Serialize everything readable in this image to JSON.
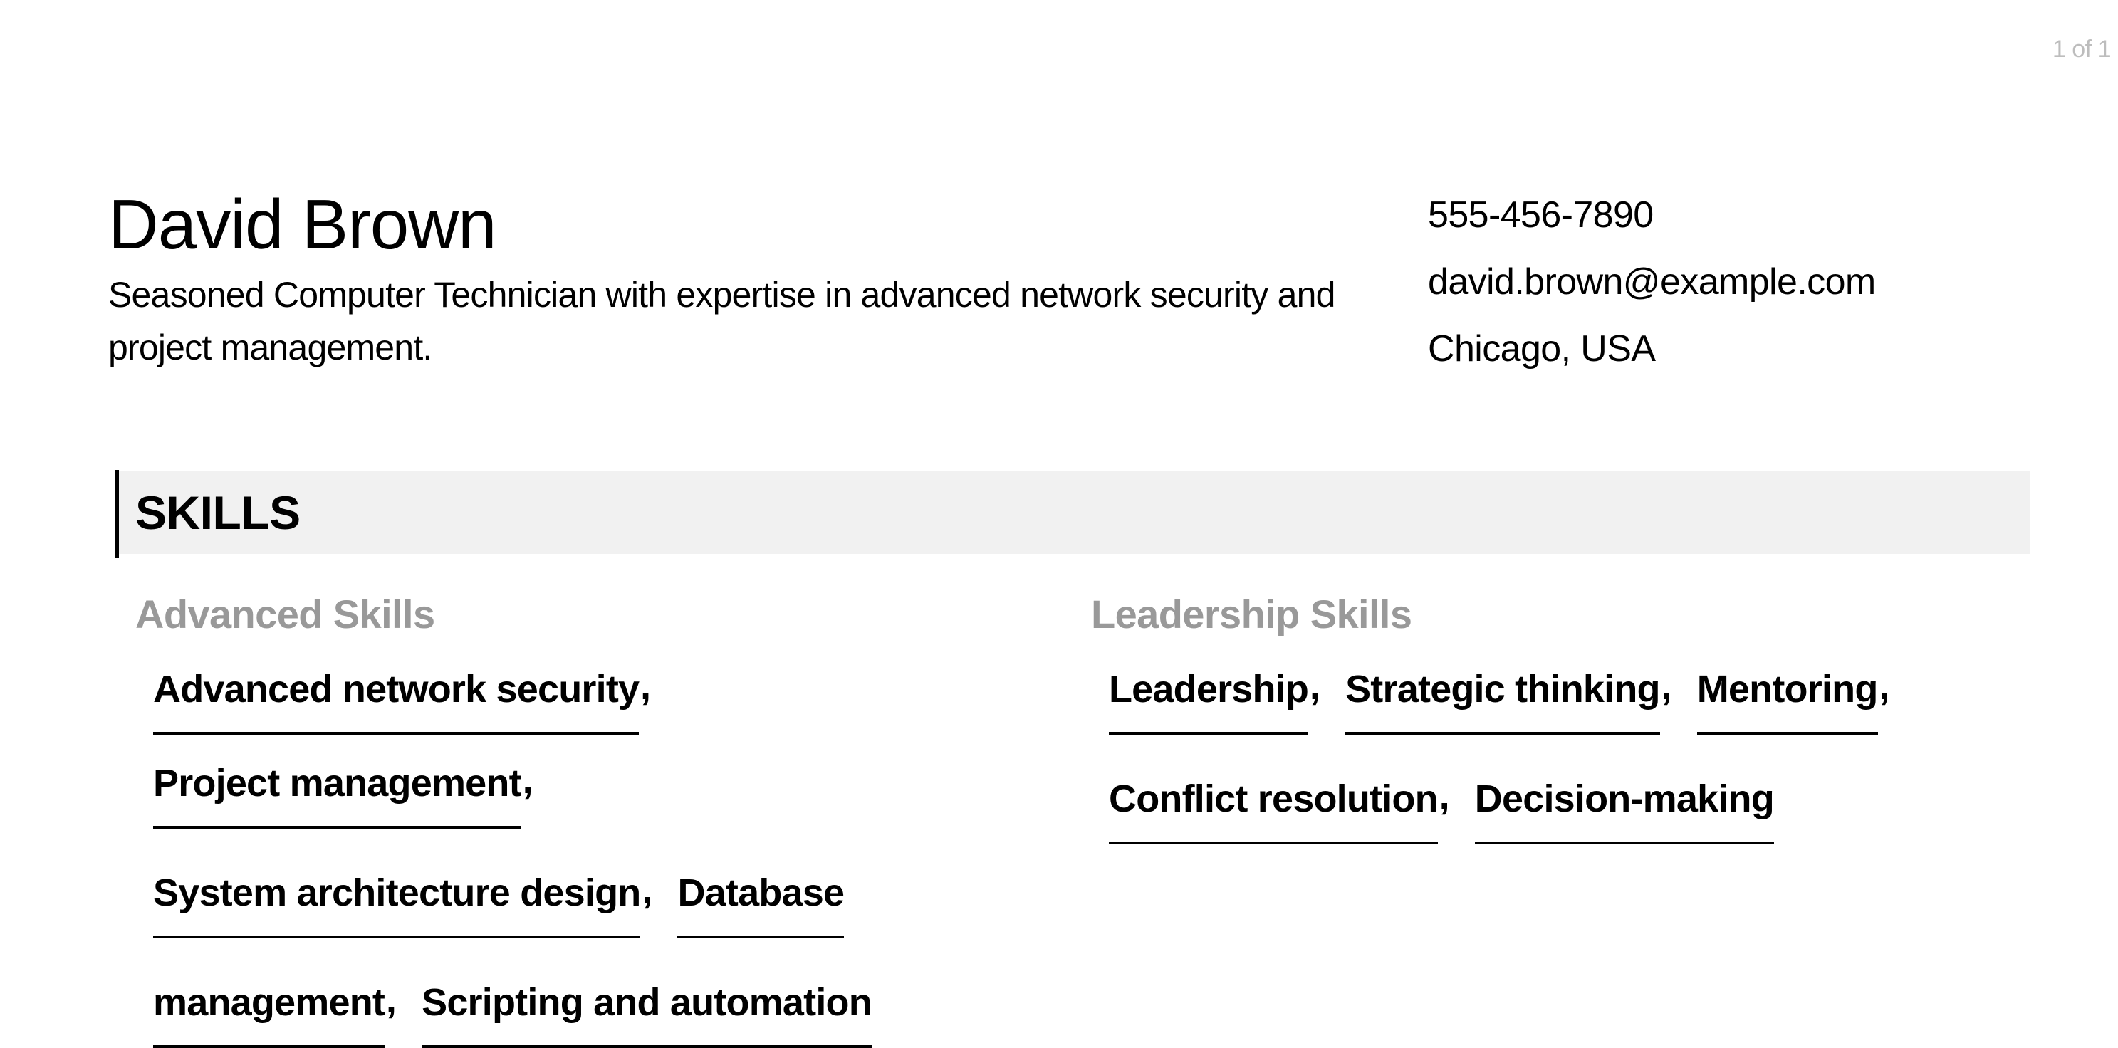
{
  "page_indicator": "1 of 1",
  "header": {
    "name": "David Brown",
    "summary": "Seasoned Computer Technician with expertise in advanced network security and project management."
  },
  "contact": {
    "phone": "555-456-7890",
    "email": "david.brown@example.com",
    "location": "Chicago, USA"
  },
  "skills_section": {
    "title": "SKILLS",
    "groups": [
      {
        "title": "Advanced Skills",
        "rows": [
          [
            {
              "label": "Advanced network security",
              "comma": ","
            },
            {
              "label": "Project management",
              "comma": ","
            }
          ],
          [
            {
              "label": "System architecture design",
              "comma": ","
            },
            {
              "label": "Database",
              "comma": ""
            }
          ],
          [
            {
              "label": "management",
              "comma": ","
            },
            {
              "label": "Scripting and automation",
              "comma": ""
            }
          ]
        ]
      },
      {
        "title": "Leadership Skills",
        "rows": [
          [
            {
              "label": "Leadership",
              "comma": ","
            },
            {
              "label": "Strategic thinking",
              "comma": ","
            },
            {
              "label": "Mentoring",
              "comma": ","
            }
          ],
          [
            {
              "label": "Conflict resolution",
              "comma": ","
            },
            {
              "label": "Decision-making",
              "comma": ""
            }
          ]
        ]
      }
    ]
  }
}
